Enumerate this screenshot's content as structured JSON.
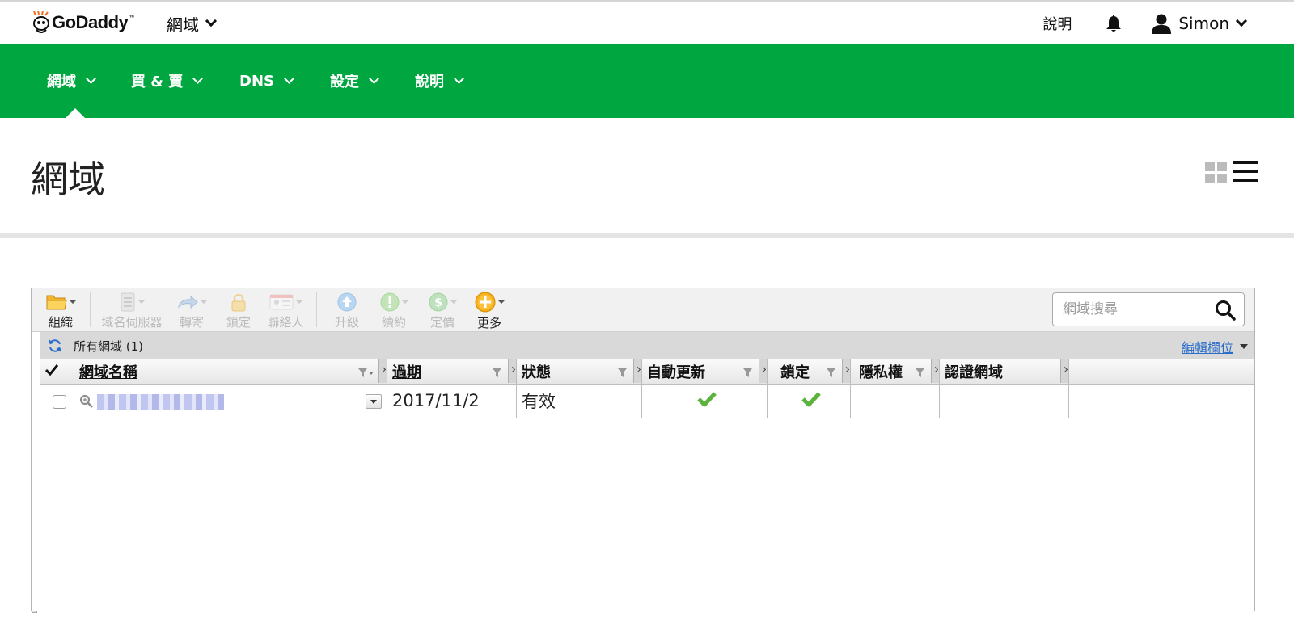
{
  "brand": {
    "name": "GoDaddy",
    "tm": "™"
  },
  "topbar": {
    "product": "網域",
    "help": "說明",
    "user": "Simon"
  },
  "nav": {
    "items": [
      {
        "label": "網域"
      },
      {
        "label": "買 & 賣"
      },
      {
        "label": "DNS"
      },
      {
        "label": "設定"
      },
      {
        "label": "說明"
      }
    ],
    "active": "網域",
    "color": "#00a63f"
  },
  "page": {
    "title": "網域"
  },
  "toolbar": {
    "organize": "組織",
    "nameservers": "域名伺服器",
    "forward": "轉寄",
    "lock": "鎖定",
    "contacts": "聯絡人",
    "upgrade": "升級",
    "renew": "續約",
    "pricing": "定價",
    "more": "更多",
    "search_placeholder": "網域搜尋"
  },
  "subbar": {
    "all_domains": "所有網域 (1)",
    "edit_columns": "編輯欄位"
  },
  "table": {
    "columns": [
      "網域名稱",
      "過期",
      "狀態",
      "自動更新",
      "鎖定",
      "隱私權",
      "認證網域"
    ],
    "rows": [
      {
        "domain": "[blurred]",
        "expires": "2017/11/2",
        "status": "有效",
        "auto_renew": true,
        "locked": true,
        "privacy": "",
        "certified": ""
      }
    ]
  },
  "icons": [
    "godaddy-logo-icon",
    "bell-icon",
    "user-icon",
    "folder-icon",
    "server-icon",
    "forward-icon",
    "lock-icon",
    "contact-card-icon",
    "upgrade-icon",
    "renew-icon",
    "pricing-icon",
    "more-icon",
    "search-icon",
    "refresh-icon",
    "filter-icon",
    "checkmark-icon",
    "magnifier-icon",
    "grid-view-icon",
    "list-view-icon"
  ]
}
